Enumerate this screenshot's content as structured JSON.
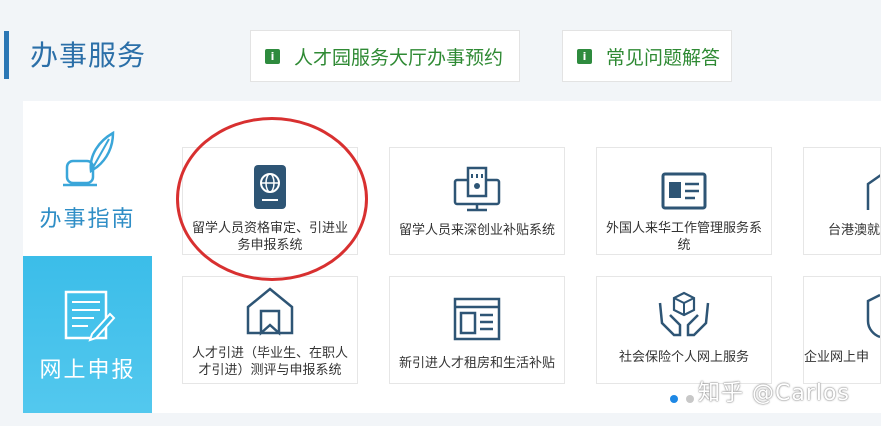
{
  "header": {
    "title": "办事服务",
    "buttons": [
      {
        "badge": "i",
        "label": "人才园服务大厅办事预约"
      },
      {
        "badge": "i",
        "label": "常见问题解答"
      }
    ]
  },
  "sidebar": {
    "tabs": [
      {
        "label": "办事指南",
        "icon": "quill-pen-icon",
        "active": false
      },
      {
        "label": "网上申报",
        "icon": "form-edit-icon",
        "active": true
      }
    ]
  },
  "services": [
    {
      "label": "留学人员资格审定、引进业务申报系统",
      "icon": "passport-icon"
    },
    {
      "label": "留学人员来深创业补贴系统",
      "icon": "monitor-document-icon"
    },
    {
      "label": "外国人来华工作管理服务系统",
      "icon": "id-card-icon"
    },
    {
      "label": "台港澳就",
      "icon": "house-outline-icon"
    },
    {
      "label": "人才引进（毕业生、在职人才引进）测评与申报系统",
      "icon": "house-bookmark-icon"
    },
    {
      "label": "新引进人才租房和生活补贴",
      "icon": "webpage-layout-icon"
    },
    {
      "label": "社会保险个人网上服务",
      "icon": "hands-box-icon"
    },
    {
      "label": "企业网上申",
      "icon": "shield-icon"
    }
  ],
  "pagination": {
    "count": 2,
    "active": 0
  },
  "watermark": "知乎 @Carlos",
  "colors": {
    "title": "#2b6fa8",
    "green": "#2e8b3e",
    "tab_active": "#3bbde9",
    "icon": "#2e5575",
    "highlight": "#d83030"
  }
}
